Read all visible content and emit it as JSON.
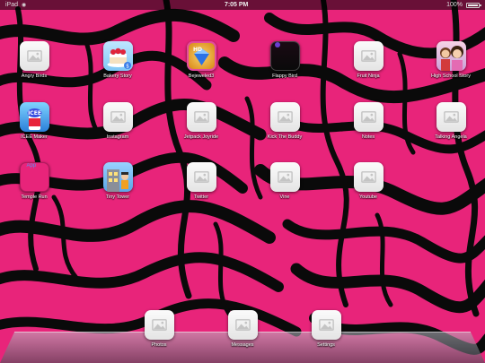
{
  "status_bar": {
    "device": "iPad",
    "time": "7:05 PM",
    "battery": "100%",
    "battery_level": 1.0
  },
  "apps": [
    {
      "id": "angry-birds",
      "label": "Angry Birds",
      "icon": "placeholder"
    },
    {
      "id": "bakery-story",
      "label": "Bakery Story",
      "icon": "bakery-story"
    },
    {
      "id": "bejeweled",
      "label": "Bejeweled3",
      "icon": "bejeweled"
    },
    {
      "id": "flappy-bird",
      "label": "Flappy Bird",
      "icon": "dark"
    },
    {
      "id": "fruit-ninja",
      "label": "Fruit Ninja",
      "icon": "placeholder"
    },
    {
      "id": "high-school-story",
      "label": "High School Story",
      "icon": "high-school-story"
    },
    {
      "id": "icee-maker",
      "label": "ICEE Maker",
      "icon": "icee-maker"
    },
    {
      "id": "instagram",
      "label": "Instagram",
      "icon": "placeholder"
    },
    {
      "id": "jetpack-joyride",
      "label": "Jetpack Joyride",
      "icon": "placeholder"
    },
    {
      "id": "kick-the-buddy",
      "label": "Kick The Buddy",
      "icon": "placeholder"
    },
    {
      "id": "notes",
      "label": "Notes",
      "icon": "placeholder"
    },
    {
      "id": "talking-angela",
      "label": "Talking Angela",
      "icon": "placeholder"
    },
    {
      "id": "temple-run",
      "label": "Temple Run",
      "icon": "broken",
      "icon_text": "App"
    },
    {
      "id": "tiny-tower",
      "label": "Tiny Tower",
      "icon": "tiny-tower"
    },
    {
      "id": "twitter",
      "label": "Twitter",
      "icon": "placeholder"
    },
    {
      "id": "vine",
      "label": "Vine",
      "icon": "placeholder"
    },
    {
      "id": "youtube",
      "label": "Youtube",
      "icon": "placeholder"
    }
  ],
  "dock": [
    {
      "id": "photos",
      "label": "Photos",
      "icon": "placeholder"
    },
    {
      "id": "messages",
      "label": "Messages",
      "icon": "placeholder"
    },
    {
      "id": "settings",
      "label": "Settings",
      "icon": "placeholder"
    }
  ],
  "colors": {
    "wallpaper_pink": "#e8247a",
    "wallpaper_black": "#0a0a0a"
  }
}
